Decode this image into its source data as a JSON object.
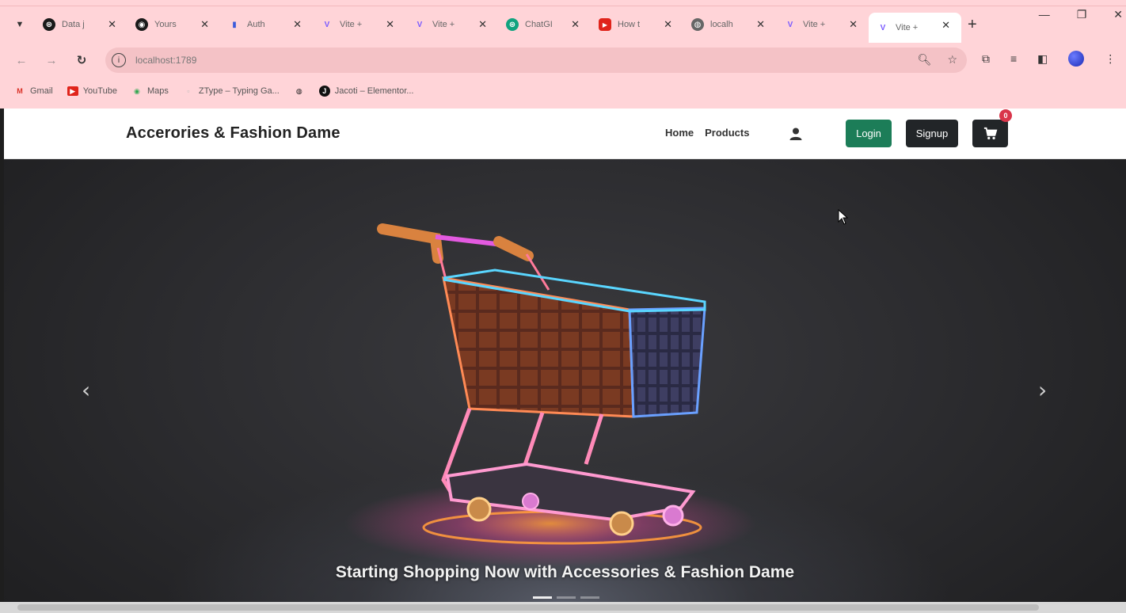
{
  "browser": {
    "tabs": [
      {
        "title": "Data j",
        "icon": "chatgpt-icon",
        "color": "#1a1a1a"
      },
      {
        "title": "Yours",
        "icon": "github-icon",
        "color": "#1a1a1a"
      },
      {
        "title": "Auth",
        "icon": "bookmark-icon",
        "color": "#3b5bdb"
      },
      {
        "title": "Vite +",
        "icon": "vite-icon",
        "color": "#7b5cff"
      },
      {
        "title": "Vite +",
        "icon": "vite-icon",
        "color": "#7b5cff"
      },
      {
        "title": "ChatGI",
        "icon": "chatgpt-icon",
        "color": "#10a37f"
      },
      {
        "title": "How t",
        "icon": "youtube-icon",
        "color": "#e0241b"
      },
      {
        "title": "localh",
        "icon": "globe-icon",
        "color": "#666666"
      },
      {
        "title": "Vite +",
        "icon": "vite-icon",
        "color": "#7b5cff"
      },
      {
        "title": "Vite +",
        "icon": "vite-icon",
        "color": "#7b5cff",
        "active": true
      }
    ],
    "url": "localhost:1789",
    "bookmarks": [
      "Gmail",
      "YouTube",
      "Maps",
      "ZType – Typing Ga...",
      "",
      "Jacoti – Elementor..."
    ]
  },
  "site": {
    "brand": "Accerories & Fashion Dame",
    "nav": [
      "Home",
      "Products"
    ],
    "login_label": "Login",
    "signup_label": "Signup",
    "cart_count": "0",
    "accent": "#1c7d58",
    "dark": "#222528"
  },
  "hero": {
    "caption": "Starting Shopping Now with Accessories & Fashion Dame",
    "slides": 3,
    "active_slide": 1
  }
}
